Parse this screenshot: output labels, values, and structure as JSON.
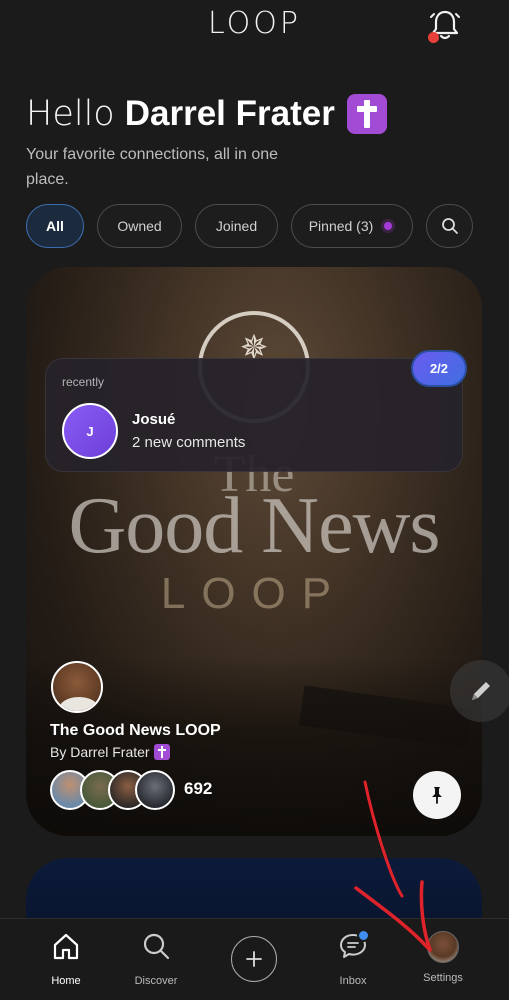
{
  "header": {
    "logo": "LOOP",
    "notification_dot_color": "#e8403a"
  },
  "greeting": {
    "hello": "Hello",
    "name": "Darrel Frater",
    "badge_icon": "latin-cross",
    "subtitle": "Your favorite connections, all in one place."
  },
  "filters": {
    "all": "All",
    "owned": "Owned",
    "joined": "Joined",
    "pinned": "Pinned (3)",
    "selected": "All"
  },
  "featured_card": {
    "cover": {
      "line1": "The",
      "line2": "Good News",
      "line3": "LOOP"
    },
    "recent": {
      "label": "recently",
      "avatar_initial": "J",
      "name": "Josué",
      "message": "2 new comments",
      "counter": "2/2"
    },
    "title": "The Good News LOOP",
    "by": "By Darrel Frater",
    "member_count": "692"
  },
  "nav": {
    "home": "Home",
    "discover": "Discover",
    "inbox": "Inbox",
    "settings": "Settings"
  },
  "colors": {
    "accent_purple": "#a24bd4",
    "accent_blue": "#3f8ef0",
    "annotation_red": "#e0232b"
  }
}
